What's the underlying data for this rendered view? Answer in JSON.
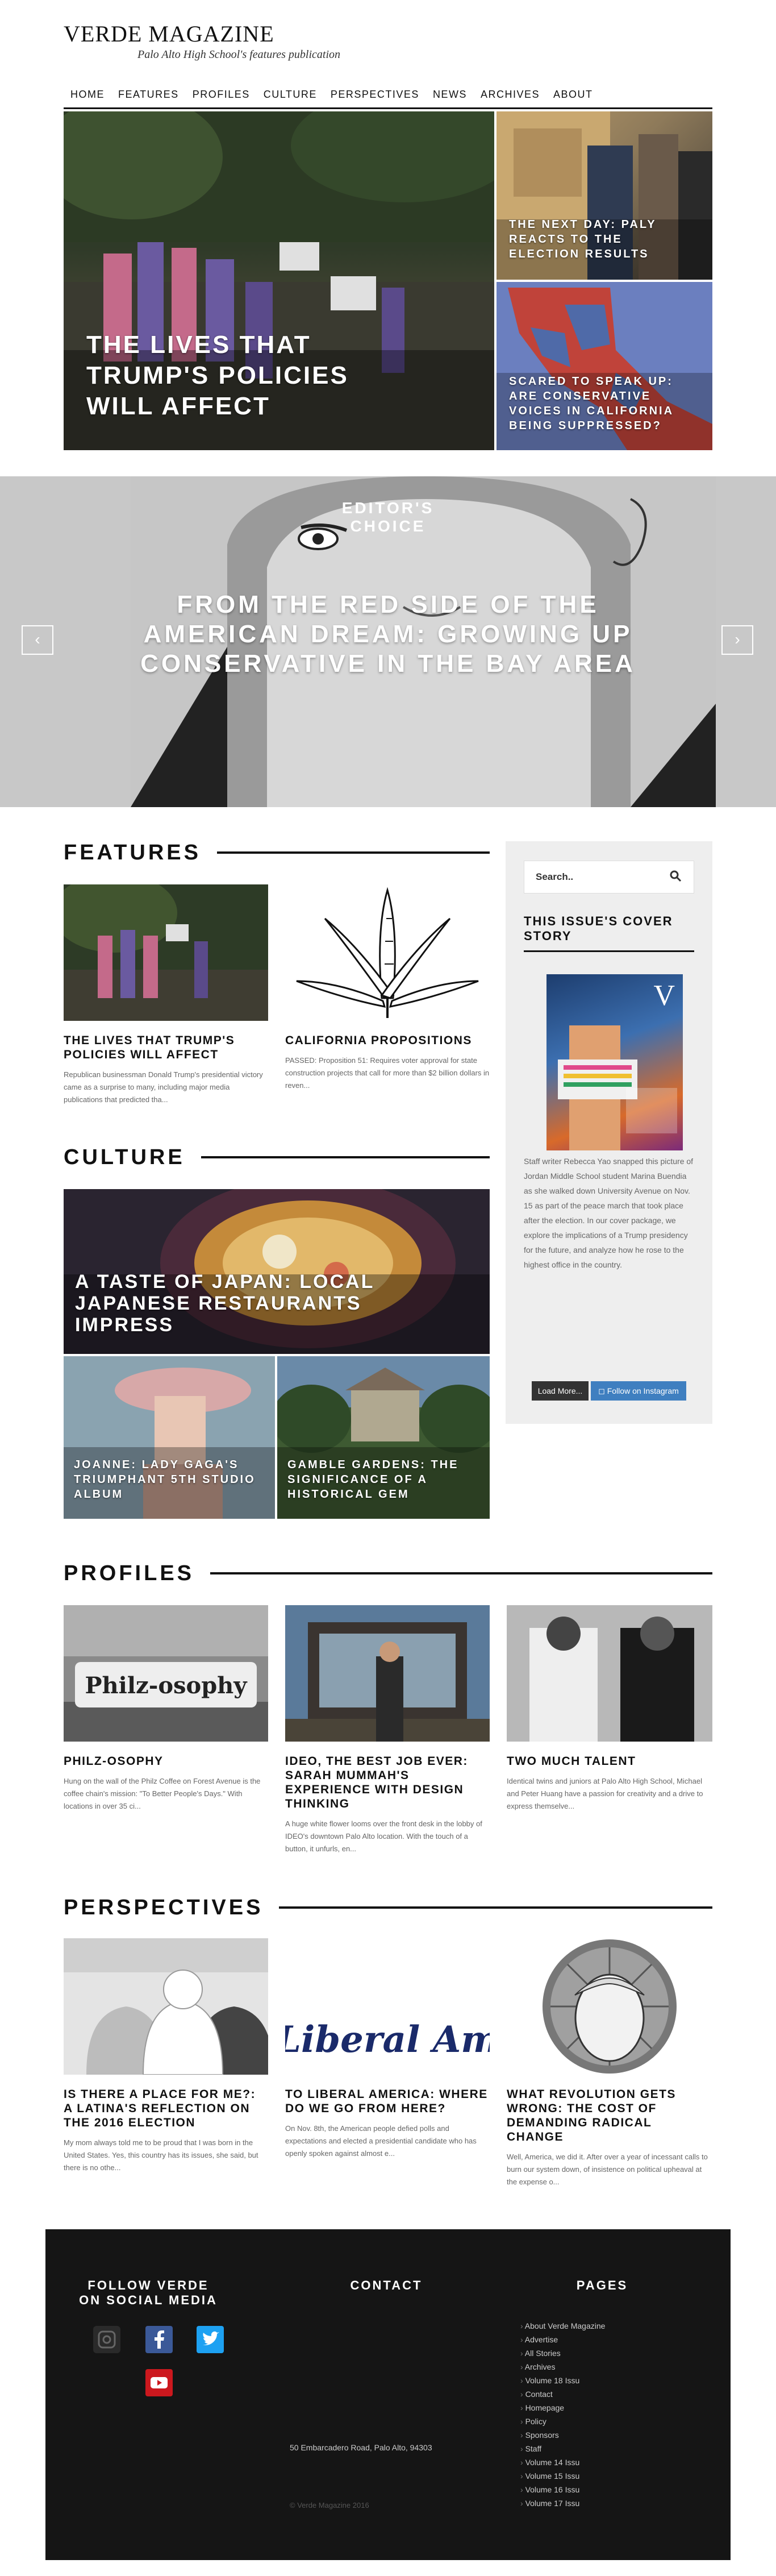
{
  "site": {
    "title": "VERDE MAGAZINE",
    "tagline": "Palo Alto High School's features publication"
  },
  "nav": [
    "HOME",
    "FEATURES",
    "PROFILES",
    "CULTURE",
    "PERSPECTIVES",
    "NEWS",
    "ARCHIVES",
    "ABOUT"
  ],
  "hero": {
    "main": "THE LIVES THAT TRUMP'S POLICIES WILL AFFECT",
    "top_right": "THE NEXT DAY: PALY REACTS TO THE ELECTION RESULTS",
    "bottom_right": "SCARED TO SPEAK UP: ARE CONSERVATIVE VOICES IN CALIFORNIA BEING SUPPRESSED?"
  },
  "editors_choice": {
    "label": "EDITOR'S CHOICE",
    "title": "FROM THE RED SIDE OF THE AMERICAN DREAM: GROWING UP CONSERVATIVE IN THE BAY AREA",
    "prev": "‹",
    "next": "›"
  },
  "features": {
    "heading": "FEATURES",
    "cards": [
      {
        "title": "THE LIVES THAT TRUMP'S POLICIES WILL AFFECT",
        "excerpt": "Republican businessman Donald Trump's presidential victory came as a surprise to many, including major media publications that predicted tha..."
      },
      {
        "title": "CALIFORNIA PROPOSITIONS",
        "excerpt": "PASSED: Proposition 51: Requires voter approval for state construction projects that call for more than $2 billion dollars in reven..."
      }
    ]
  },
  "culture": {
    "heading": "CULTURE",
    "big": "A TASTE OF JAPAN: LOCAL JAPANESE RESTAURANTS IMPRESS",
    "left": "JOANNE: LADY GAGA'S TRIUMPHANT 5TH STUDIO ALBUM",
    "right": "GAMBLE GARDENS: THE SIGNIFICANCE OF A HISTORICAL GEM"
  },
  "sidebar": {
    "search_placeholder": "Search..",
    "cover_heading": "THIS ISSUE'S COVER STORY",
    "cover_letter": "V",
    "cover_text": "Staff writer Rebecca Yao snapped this picture of Jordan Middle School student Marina Buendia as she walked down University Avenue on Nov. 15 as part of the peace march that took place after the election. In our cover package, we explore the implications of a Trump presidency for the future, and analyze how he rose to the highest office in the country.",
    "load_more": "Load More...",
    "follow_instagram": "Follow on Instagram"
  },
  "profiles": {
    "heading": "PROFILES",
    "cards": [
      {
        "title": "PHILZ-OSOPHY",
        "excerpt": "Hung on the wall of the Philz Coffee on Forest Avenue is the coffee chain's mission: \"To Better People's Days.\" With locations in over 35 ci...",
        "img_text": "Philz-osophy"
      },
      {
        "title": "IDEO, THE BEST JOB EVER: SARAH MUMMAH'S EXPERIENCE WITH DESIGN THINKING",
        "excerpt": "A huge white flower looms over the front desk in the lobby of IDEO's downtown Palo Alto location. With the touch of a button, it unfurls, en..."
      },
      {
        "title": "TWO MUCH TALENT",
        "excerpt": "Identical twins and juniors at Palo Alto High School, Michael and Peter Huang have a passion for creativity and a drive to express themselve..."
      }
    ]
  },
  "perspectives": {
    "heading": "PERSPECTIVES",
    "cards": [
      {
        "title": "IS THERE A PLACE FOR ME?: A LATINA'S REFLECTION ON THE 2016 ELECTION",
        "excerpt": "My mom always told me to be proud that I was born in the United States. Yes, this country has its issues, she said, but there is no othe..."
      },
      {
        "title": "TO LIBERAL AMERICA: WHERE DO WE GO FROM HERE?",
        "excerpt": "On Nov. 8th, the American people defied polls and expectations and elected a presidential candidate who has openly spoken against almost e...",
        "img_text": "Liberal Am"
      },
      {
        "title": "WHAT REVOLUTION GETS WRONG: THE COST OF DEMANDING RADICAL CHANGE",
        "excerpt": "Well, America, we did it. After over a year of incessant calls to burn our system down, of insistence on political upheaval at the expense o..."
      }
    ]
  },
  "footer": {
    "social_heading": "FOLLOW VERDE ON SOCIAL MEDIA",
    "contact_heading": "CONTACT",
    "pages_heading": "PAGES",
    "address": "50 Embarcadero Road, Palo Alto, 94303",
    "copyright": "© Verde Magazine 2016",
    "pages": [
      "About Verde Magazine",
      "Advertise",
      "All Stories",
      "Archives",
      "Volume 18 Issu",
      "Contact",
      "Homepage",
      "Policy",
      "Sponsors",
      "Staff",
      "Volume 14 Issu",
      "Volume 15 Issu",
      "Volume 16 Issu",
      "Volume 17 Issu"
    ],
    "icons": [
      "instagram-icon",
      "facebook-icon",
      "twitter-icon",
      "youtube-icon"
    ]
  },
  "colors": {
    "accent_dark": "#111111",
    "footer_bg": "#151515",
    "instagram_button": "#3f7fc0",
    "facebook": "#3b5998",
    "twitter": "#1da1f2",
    "youtube": "#cc181e"
  }
}
